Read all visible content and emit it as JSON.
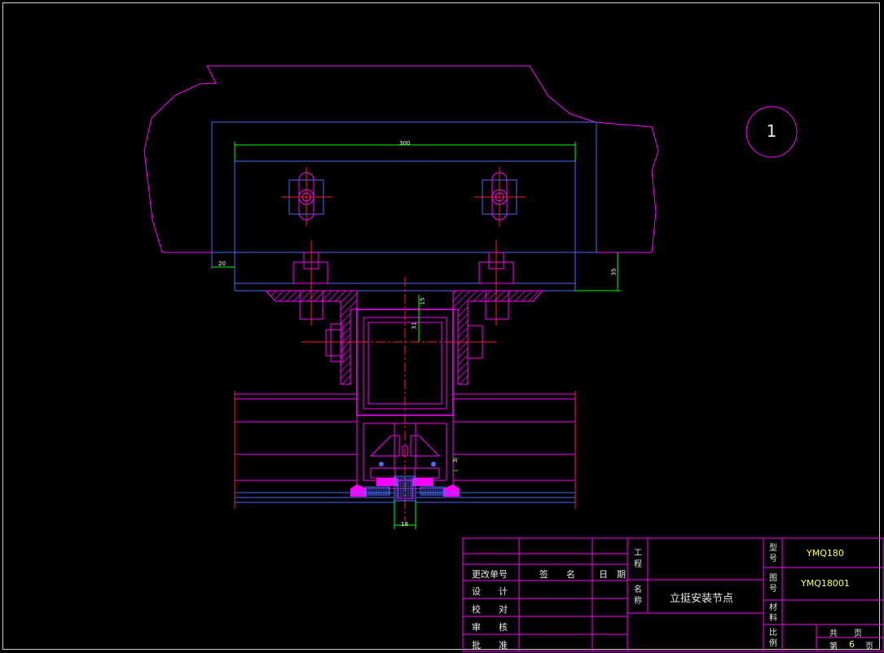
{
  "drawing": {
    "detail_marker": "1",
    "dimensions": {
      "width_300": "300",
      "left_20": "20",
      "right_35": "35",
      "gap_15": "15",
      "depth_31": "31",
      "small_3": "3",
      "bottom_18": "18"
    }
  },
  "title_block": {
    "change_no": "更改单号",
    "signature": "签　　名",
    "date": "日　期",
    "design": "设　　计",
    "check": "校　　对",
    "review": "审　　核",
    "approve": "批　　准",
    "project_label": "工程",
    "name_label": "名称",
    "drawing_name": "立挺安装节点",
    "type_label": "型号",
    "type_value": "YMQ180",
    "drawing_no_label": "图号",
    "drawing_no_value": "YMQ18001",
    "material_label": "材料",
    "scale_label": "比例",
    "total_pages": "共　　页",
    "page_prefix": "第",
    "page_value": "6",
    "page_suffix": "页"
  },
  "colors": {
    "background": "#000000",
    "magenta": "#ff00ff",
    "blue": "#4a6cff",
    "red": "#ff2020",
    "green": "#00ff00",
    "frame": "#cfcfcf"
  }
}
